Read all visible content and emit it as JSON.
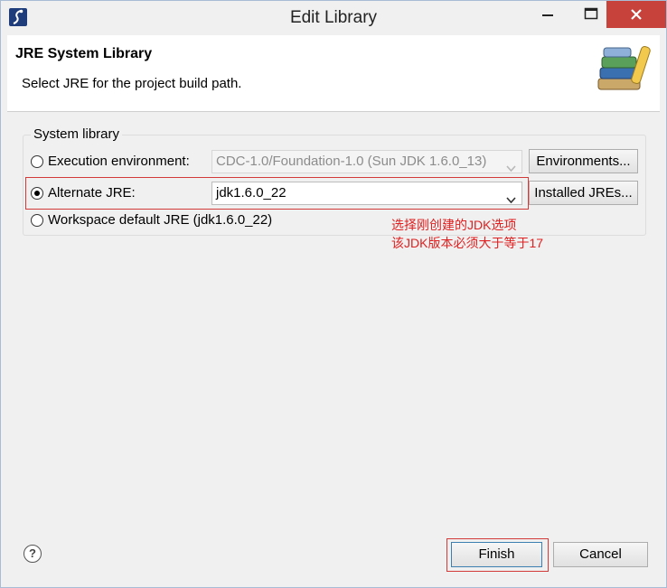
{
  "window": {
    "title": "Edit Library",
    "close_color": "#c7423b"
  },
  "header": {
    "title": "JRE System Library",
    "description": "Select JRE for the project build path.",
    "icon": "books-icon"
  },
  "group": {
    "label": "System library",
    "exec_env": {
      "label": "Execution environment:",
      "value": "CDC-1.0/Foundation-1.0 (Sun JDK 1.6.0_13)",
      "button": "Environments...",
      "selected": false
    },
    "alt_jre": {
      "label": "Alternate JRE:",
      "value": "jdk1.6.0_22",
      "button": "Installed JREs...",
      "selected": true
    },
    "workspace": {
      "label": "Workspace default JRE (jdk1.6.0_22)",
      "selected": false
    }
  },
  "annotation": {
    "line1": "选择刚创建的JDK选项",
    "line2": "该JDK版本必须大于等于17",
    "color": "#e02020"
  },
  "footer": {
    "finish": "Finish",
    "cancel": "Cancel",
    "help_icon": "help-icon"
  }
}
